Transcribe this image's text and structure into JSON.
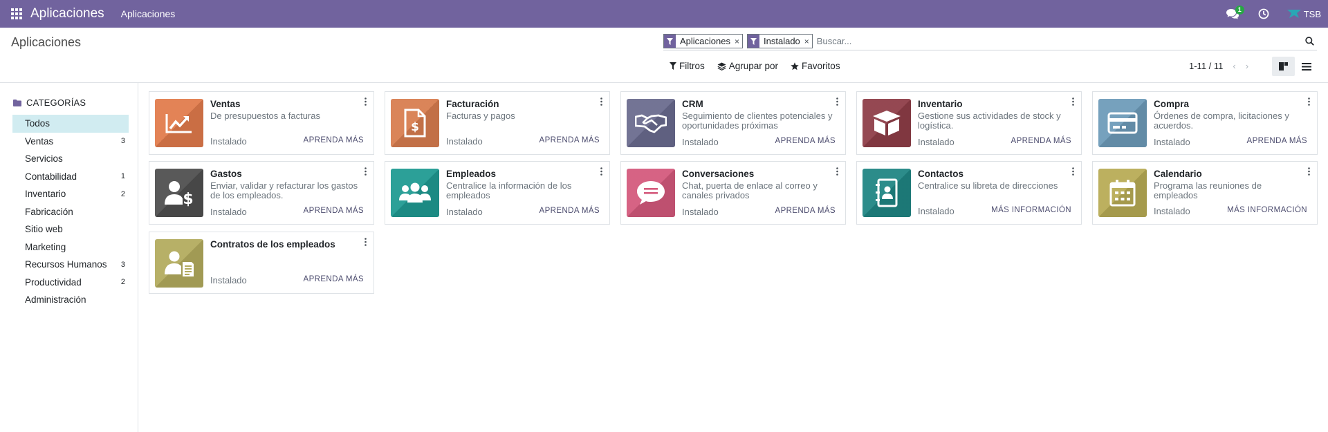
{
  "topbar": {
    "brand": "Aplicaciones",
    "menu": "Aplicaciones",
    "messages_count": "1",
    "user_label": "TSB"
  },
  "control": {
    "title": "Aplicaciones",
    "facets": [
      {
        "label": "Aplicaciones",
        "remove": "×"
      },
      {
        "label": "Instalado",
        "remove": "×"
      }
    ],
    "search_placeholder": "Buscar...",
    "filters_label": "Filtros",
    "groupby_label": "Agrupar por",
    "favorites_label": "Favoritos",
    "pager": "1-11 / 11",
    "pager_prev": "‹",
    "pager_next": "›"
  },
  "sidebar": {
    "header": "CATEGORÍAS",
    "items": [
      {
        "label": "Todos",
        "count": ""
      },
      {
        "label": "Ventas",
        "count": "3"
      },
      {
        "label": "Servicios",
        "count": ""
      },
      {
        "label": "Contabilidad",
        "count": "1"
      },
      {
        "label": "Inventario",
        "count": "2"
      },
      {
        "label": "Fabricación",
        "count": ""
      },
      {
        "label": "Sitio web",
        "count": ""
      },
      {
        "label": "Marketing",
        "count": ""
      },
      {
        "label": "Recursos Humanos",
        "count": "3"
      },
      {
        "label": "Productividad",
        "count": "2"
      },
      {
        "label": "Administración",
        "count": ""
      }
    ]
  },
  "apps": [
    {
      "name": "Ventas",
      "summary": "De presupuestos a facturas",
      "status": "Instalado",
      "action": "APRENDA MÁS",
      "color": "#e17b4c",
      "icon": "chart-trend-icon"
    },
    {
      "name": "Facturación",
      "summary": "Facturas y pagos",
      "status": "Instalado",
      "action": "APRENDA MÁS",
      "color": "#d87d4f",
      "icon": "invoice-dollar-icon"
    },
    {
      "name": "CRM",
      "summary": "Seguimiento de clientes potenciales y oportunidades próximas",
      "status": "Instalado",
      "action": "APRENDA MÁS",
      "color": "#6a6b8e",
      "icon": "handshake-icon"
    },
    {
      "name": "Inventario",
      "summary": "Gestione sus actividades de stock y logística.",
      "status": "Instalado",
      "action": "APRENDA MÁS",
      "color": "#8e3d47",
      "icon": "box-icon"
    },
    {
      "name": "Compra",
      "summary": "Órdenes de compra, licitaciones y acuerdos.",
      "status": "Instalado",
      "action": "APRENDA MÁS",
      "color": "#6d9bb9",
      "icon": "credit-card-icon"
    },
    {
      "name": "Gastos",
      "summary": "Enviar, validar y refacturar los gastos de los empleados.",
      "status": "Instalado",
      "action": "APRENDA MÁS",
      "color": "#4f4f4f",
      "icon": "user-dollar-icon"
    },
    {
      "name": "Empleados",
      "summary": "Centralice la información de los empleados",
      "status": "Instalado",
      "action": "APRENDA MÁS",
      "color": "#1f9a92",
      "icon": "users-icon"
    },
    {
      "name": "Conversaciones",
      "summary": "Chat, puerta de enlace al correo y canales privados",
      "status": "Instalado",
      "action": "APRENDA MÁS",
      "color": "#d4597c",
      "icon": "chat-bubble-icon"
    },
    {
      "name": "Contactos",
      "summary": "Centralice su libreta de direcciones",
      "status": "Instalado",
      "action": "MÁS INFORMACIÓN",
      "color": "#1f8583",
      "icon": "address-book-icon"
    },
    {
      "name": "Calendario",
      "summary": "Programa las reuniones de empleados",
      "status": "Instalado",
      "action": "MÁS INFORMACIÓN",
      "color": "#b8ab55",
      "icon": "calendar-icon"
    },
    {
      "name": "Contratos de los empleados",
      "summary": "",
      "status": "Instalado",
      "action": "APRENDA MÁS",
      "color": "#b3ab5e",
      "icon": "contract-icon"
    }
  ]
}
